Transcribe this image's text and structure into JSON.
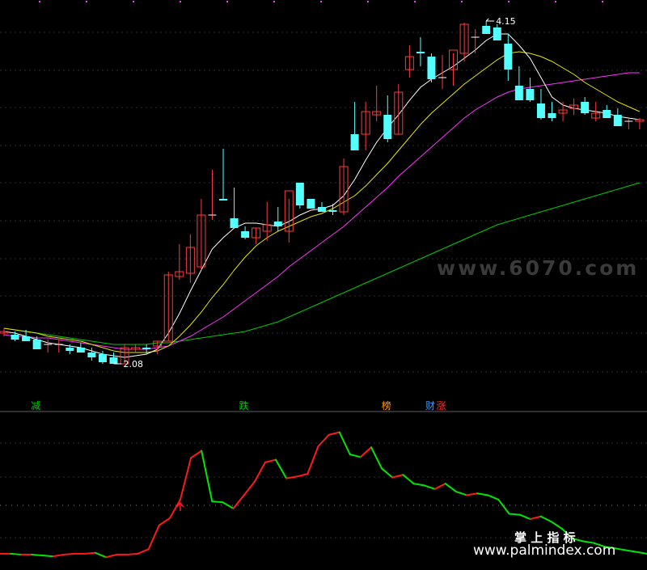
{
  "chart_data": [
    {
      "type": "candlestick",
      "x_count": 66,
      "price_range": [
        1.85,
        4.25
      ],
      "colors": {
        "up": "#ff3b3b",
        "down": "#54ffff",
        "ma5": "#ffffff",
        "ma10": "#e6e600",
        "ma20": "#ff33ff",
        "ma60": "#00cc00"
      },
      "candles": [
        [
          2.27,
          2.3,
          2.25,
          2.28
        ],
        [
          2.26,
          2.28,
          2.22,
          2.23
        ],
        [
          2.25,
          2.29,
          2.23,
          2.22
        ],
        [
          2.23,
          2.25,
          2.2,
          2.17
        ],
        [
          2.2,
          2.23,
          2.15,
          2.2
        ],
        [
          2.2,
          2.23,
          2.15,
          2.2
        ],
        [
          2.18,
          2.2,
          2.14,
          2.16
        ],
        [
          2.18,
          2.21,
          2.15,
          2.15
        ],
        [
          2.15,
          2.18,
          2.1,
          2.12
        ],
        [
          2.14,
          2.16,
          2.08,
          2.09
        ],
        [
          2.12,
          2.15,
          2.08,
          2.08
        ],
        [
          2.08,
          2.2,
          2.08,
          2.18
        ],
        [
          2.17,
          2.2,
          2.15,
          2.18
        ],
        [
          2.18,
          2.2,
          2.14,
          2.17
        ],
        [
          2.19,
          2.22,
          2.14,
          2.22
        ],
        [
          2.22,
          2.65,
          2.22,
          2.63
        ],
        [
          2.62,
          2.82,
          2.6,
          2.65
        ],
        [
          2.64,
          2.88,
          2.58,
          2.8
        ],
        [
          2.68,
          3.1,
          2.66,
          3.0
        ],
        [
          3.0,
          3.28,
          2.97,
          3.0
        ],
        [
          3.1,
          3.41,
          3.1,
          3.09
        ],
        [
          2.98,
          3.17,
          2.93,
          2.92
        ],
        [
          2.9,
          2.93,
          2.85,
          2.86
        ],
        [
          2.86,
          2.92,
          2.82,
          2.92
        ],
        [
          2.9,
          3.08,
          2.84,
          2.94
        ],
        [
          2.96,
          3.05,
          2.9,
          2.93
        ],
        [
          2.9,
          3.1,
          2.83,
          3.15
        ],
        [
          3.2,
          3.17,
          3.04,
          3.06
        ],
        [
          3.1,
          3.1,
          3.04,
          3.04
        ],
        [
          3.05,
          3.08,
          3.02,
          3.02
        ],
        [
          3.03,
          3.07,
          3.0,
          3.02
        ],
        [
          3.02,
          3.35,
          3.0,
          3.3
        ],
        [
          3.5,
          3.7,
          3.4,
          3.4
        ],
        [
          3.5,
          3.7,
          3.4,
          3.64
        ],
        [
          3.62,
          3.8,
          3.58,
          3.64
        ],
        [
          3.62,
          3.74,
          3.45,
          3.47
        ],
        [
          3.5,
          3.81,
          3.5,
          3.76
        ],
        [
          3.9,
          4.05,
          3.85,
          3.98
        ],
        [
          4.01,
          4.1,
          3.92,
          4.0
        ],
        [
          3.98,
          4.0,
          3.82,
          3.84
        ],
        [
          3.85,
          3.99,
          3.78,
          3.85
        ],
        [
          3.9,
          4.0,
          3.8,
          4.02
        ],
        [
          4.0,
          4.19,
          3.95,
          4.18
        ],
        [
          4.1,
          4.15,
          4.0,
          4.1
        ],
        [
          4.17,
          4.2,
          4.14,
          4.12
        ],
        [
          4.16,
          4.18,
          4.1,
          4.08
        ],
        [
          4.06,
          4.12,
          3.83,
          3.9
        ],
        [
          3.8,
          3.92,
          3.72,
          3.71
        ],
        [
          3.78,
          3.85,
          3.7,
          3.71
        ],
        [
          3.69,
          3.78,
          3.59,
          3.6
        ],
        [
          3.63,
          3.7,
          3.58,
          3.6
        ],
        [
          3.63,
          3.7,
          3.58,
          3.65
        ],
        [
          3.66,
          3.72,
          3.62,
          3.68
        ],
        [
          3.7,
          3.73,
          3.62,
          3.63
        ],
        [
          3.6,
          3.7,
          3.58,
          3.63
        ],
        [
          3.65,
          3.68,
          3.6,
          3.6
        ],
        [
          3.62,
          3.66,
          3.56,
          3.55
        ],
        [
          3.58,
          3.6,
          3.53,
          3.58
        ],
        [
          3.58,
          3.6,
          3.53,
          3.59
        ]
      ],
      "ma5": [
        2.28,
        2.27,
        2.25,
        2.23,
        2.21,
        2.2,
        2.19,
        2.18,
        2.16,
        2.14,
        2.13,
        2.12,
        2.13,
        2.14,
        2.17,
        2.27,
        2.39,
        2.53,
        2.66,
        2.79,
        2.86,
        2.92,
        2.95,
        2.95,
        2.94,
        2.93,
        2.96,
        3.0,
        3.03,
        3.04,
        3.06,
        3.12,
        3.22,
        3.34,
        3.45,
        3.54,
        3.62,
        3.71,
        3.79,
        3.84,
        3.88,
        3.92,
        3.97,
        4.02,
        4.08,
        4.12,
        4.12,
        4.05,
        3.97,
        3.85,
        3.73,
        3.68,
        3.66,
        3.65,
        3.64,
        3.63,
        3.61,
        3.6,
        3.59
      ],
      "ma10": [
        2.3,
        2.29,
        2.28,
        2.27,
        2.25,
        2.24,
        2.23,
        2.22,
        2.2,
        2.18,
        2.16,
        2.15,
        2.15,
        2.15,
        2.16,
        2.19,
        2.25,
        2.32,
        2.4,
        2.49,
        2.57,
        2.66,
        2.74,
        2.81,
        2.86,
        2.9,
        2.93,
        2.96,
        2.99,
        3.01,
        3.04,
        3.08,
        3.12,
        3.18,
        3.25,
        3.32,
        3.4,
        3.48,
        3.56,
        3.63,
        3.69,
        3.75,
        3.81,
        3.86,
        3.91,
        3.96,
        4.0,
        4.01,
        4.0,
        3.98,
        3.95,
        3.91,
        3.87,
        3.82,
        3.78,
        3.74,
        3.7,
        3.67,
        3.64
      ],
      "ma20": [
        2.26,
        2.25,
        2.25,
        2.24,
        2.24,
        2.23,
        2.22,
        2.21,
        2.2,
        2.19,
        2.18,
        2.17,
        2.17,
        2.17,
        2.18,
        2.19,
        2.22,
        2.25,
        2.29,
        2.33,
        2.37,
        2.42,
        2.47,
        2.52,
        2.57,
        2.62,
        2.68,
        2.73,
        2.78,
        2.83,
        2.88,
        2.93,
        2.99,
        3.05,
        3.11,
        3.17,
        3.24,
        3.3,
        3.36,
        3.42,
        3.48,
        3.54,
        3.6,
        3.65,
        3.69,
        3.73,
        3.76,
        3.78,
        3.79,
        3.8,
        3.81,
        3.82,
        3.83,
        3.84,
        3.85,
        3.86,
        3.87,
        3.88,
        3.88
      ],
      "ma60": [
        2.3,
        2.29,
        2.28,
        2.27,
        2.26,
        2.25,
        2.24,
        2.23,
        2.22,
        2.21,
        2.2,
        2.2,
        2.2,
        2.2,
        2.21,
        2.21,
        2.22,
        2.23,
        2.24,
        2.25,
        2.26,
        2.27,
        2.28,
        2.3,
        2.32,
        2.34,
        2.37,
        2.4,
        2.43,
        2.46,
        2.49,
        2.52,
        2.55,
        2.58,
        2.61,
        2.64,
        2.67,
        2.7,
        2.73,
        2.76,
        2.79,
        2.82,
        2.85,
        2.88,
        2.91,
        2.94,
        2.96,
        2.98,
        3.0,
        3.02,
        3.04,
        3.06,
        3.08,
        3.1,
        3.12,
        3.14,
        3.16,
        3.18,
        3.2
      ],
      "annotations": [
        {
          "text": "4.15",
          "candle": 44,
          "price": 4.2
        },
        {
          "text": "2.08",
          "candle": 10,
          "price": 2.08
        }
      ],
      "signal_labels": [
        {
          "text": "减",
          "candle": 2,
          "color": "#00cc00"
        },
        {
          "text": "跌",
          "candle": 21,
          "color": "#00cc00"
        },
        {
          "text": "榜",
          "candle": 34,
          "color": "#ff9900"
        },
        {
          "text": "财",
          "candle": 38,
          "color": "#3399ff"
        },
        {
          "text": "涨",
          "candle": 39,
          "color": "#ff3333"
        }
      ]
    },
    {
      "type": "line",
      "values": [
        12,
        12,
        11,
        11,
        10,
        9,
        11,
        12,
        12,
        13,
        8,
        11,
        11,
        12,
        17,
        44,
        52,
        73,
        120,
        128,
        71,
        70,
        63,
        78,
        93,
        115,
        118,
        97,
        99,
        102,
        133,
        146,
        149,
        124,
        121,
        132,
        108,
        98,
        101,
        91,
        89,
        85,
        91,
        82,
        78,
        80,
        78,
        73,
        57,
        56,
        51,
        54,
        48,
        40,
        29,
        26,
        24,
        20,
        18,
        16,
        14,
        12
      ],
      "range": [
        0,
        155
      ],
      "marker_index": 17,
      "colors": {
        "rising": "#ff1a1a",
        "falling": "#00e600"
      }
    }
  ],
  "watermark": {
    "site": "www.6070.com",
    "brand": "掌 上 指 标",
    "url": "www.palmindex.com"
  }
}
